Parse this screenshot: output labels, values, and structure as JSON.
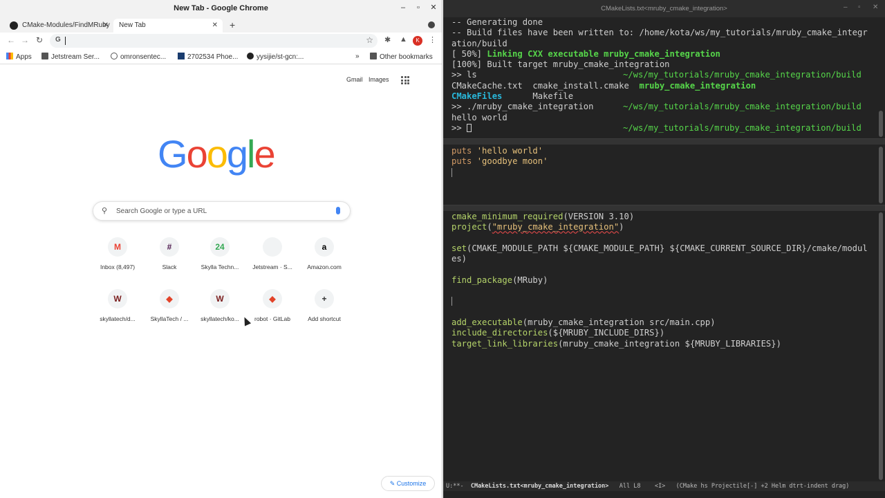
{
  "chrome": {
    "window_title": "New Tab - Google Chrome",
    "tabs": [
      {
        "label": "CMake-Modules/FindMRuby",
        "active": false
      },
      {
        "label": "New Tab",
        "active": true
      }
    ],
    "newtab_symbol": "+",
    "omnibox": {
      "value": ""
    },
    "profile_initial": "K",
    "bookmarks": [
      {
        "label": "Apps",
        "icon": "apps-icon"
      },
      {
        "label": "Jetstream Ser...",
        "icon": "folder-icon"
      },
      {
        "label": "omronsentec...",
        "icon": "globe-icon"
      },
      {
        "label": "2702534 Phoe...",
        "icon": "image-icon"
      },
      {
        "label": "yysijie/st-gcn:...",
        "icon": "github-icon"
      }
    ],
    "bookmarks_overflow": "»",
    "other_bookmarks": "Other bookmarks",
    "ntp": {
      "gmail_link": "Gmail",
      "images_link": "Images",
      "logo_letters": [
        "G",
        "o",
        "o",
        "g",
        "l",
        "e"
      ],
      "logo_colors": [
        "#4285F4",
        "#EA4335",
        "#FBBC05",
        "#4285F4",
        "#34A853",
        "#EA4335"
      ],
      "search_placeholder": "Search Google or type a URL",
      "shortcuts": [
        {
          "label": "Inbox (8,497)",
          "glyph": "M",
          "color": "#ea4335"
        },
        {
          "label": "Slack",
          "glyph": "#",
          "color": "#4a154b"
        },
        {
          "label": "Skylla Techn...",
          "glyph": "24",
          "color": "#34a853"
        },
        {
          "label": "Jetstream · S...",
          "glyph": "",
          "color": "#cccccc"
        },
        {
          "label": "Amazon.com",
          "glyph": "a",
          "color": "#000000"
        },
        {
          "label": "skyllatech/d...",
          "glyph": "W",
          "color": "#7a1e1e"
        },
        {
          "label": "SkyllaTech / ...",
          "glyph": "◆",
          "color": "#e24329"
        },
        {
          "label": "skyllatech/ko...",
          "glyph": "W",
          "color": "#7a1e1e"
        },
        {
          "label": "robot · GitLab",
          "glyph": "◆",
          "color": "#e24329"
        },
        {
          "label": "Add shortcut",
          "glyph": "+",
          "color": "#333333"
        }
      ],
      "customize_label": "Customize"
    }
  },
  "emacs": {
    "window_title": "CMakeLists.txt<mruby_cmake_integration>",
    "terminal": {
      "lines": [
        "-- Generating done",
        "-- Build files have been written to: /home/kota/ws/my_tutorials/mruby_cmake_integr",
        "ation/build"
      ],
      "link_progress": "[ 50%] ",
      "link_text": "Linking CXX executable mruby_cmake_integration",
      "built_line": "[100%] Built target mruby_cmake_integration",
      "prompt": ">> ",
      "cwd": "~/ws/my_tutorials/mruby_cmake_integration/build",
      "cmd_ls": "ls",
      "ls_row1_plain": "CMakeCache.txt  cmake_install.cmake  ",
      "ls_exec": "mruby_cmake_integration",
      "ls_dir": "CMakeFiles",
      "ls_makefile": "Makefile",
      "cmd_run": "./mruby_cmake_integration",
      "output": "hello world"
    },
    "ruby_buffer": {
      "lines": [
        {
          "kw": "puts",
          "str": "'hello world'"
        },
        {
          "kw": "puts",
          "str": "'goodbye moon'"
        }
      ]
    },
    "cmake_buffer": {
      "l1_fn": "cmake_minimum_required",
      "l1_rest": "(VERSION 3.10)",
      "l2_fn": "project",
      "l2_open": "(",
      "l2_str": "\"mruby_cmake_integration\"",
      "l2_close": ")",
      "l4_fn": "set",
      "l4_rest": "(CMAKE_MODULE_PATH ${CMAKE_MODULE_PATH} ${CMAKE_CURRENT_SOURCE_DIR}/cmake/modul",
      "l5_rest": "es)",
      "l7_fn": "find_package",
      "l7_rest": "(MRuby)",
      "l11_fn": "add_executable",
      "l11_rest": "(mruby_cmake_integration src/main.cpp)",
      "l12_fn": "include_directories",
      "l12_rest": "(${MRUBY_INCLUDE_DIRS})",
      "l13_fn": "target_link_libraries",
      "l13_rest": "(mruby_cmake_integration ${MRUBY_LIBRARIES})"
    },
    "modeline": {
      "state": "U:**-  ",
      "buffer": "CMakeLists.txt<mruby_cmake_integration>",
      "rest": "   All L8    <I>   (CMake hs Projectile[-] +2 Helm dtrt-indent drag)"
    }
  }
}
